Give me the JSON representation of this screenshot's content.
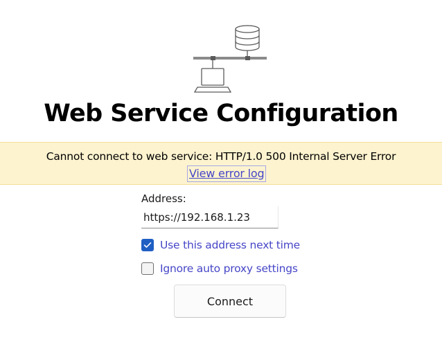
{
  "header": {
    "title": "Web Service Configuration",
    "illustration_icon": "network-server-icon"
  },
  "error_banner": {
    "message": "Cannot connect to web service: HTTP/1.0 500 Internal Server Error",
    "link_label": "View error log",
    "background_color": "#fdf3cf"
  },
  "form": {
    "address_label": "Address:",
    "address_value": "https://192.168.1.23",
    "options": [
      {
        "label": "Use this address next time",
        "checked": true
      },
      {
        "label": "Ignore auto proxy settings",
        "checked": false
      }
    ],
    "connect_label": "Connect"
  },
  "colors": {
    "accent": "#1f5fc4",
    "link": "#4646c8"
  }
}
